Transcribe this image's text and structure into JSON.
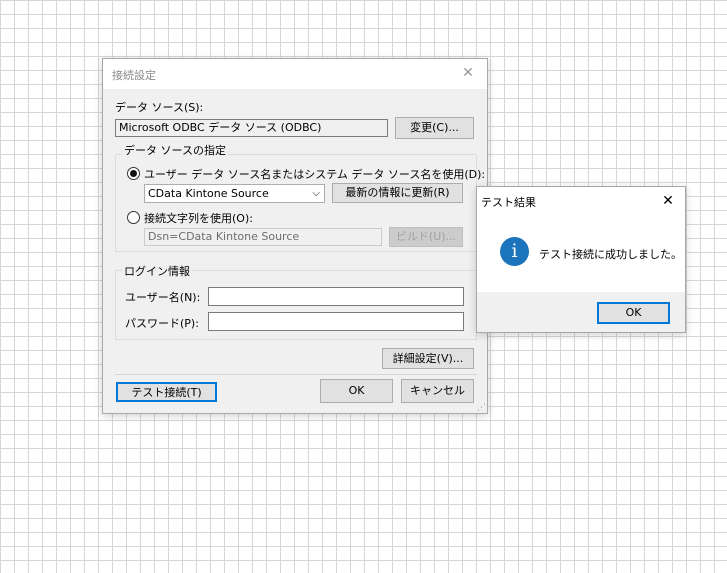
{
  "main_dialog": {
    "title": "接続設定",
    "data_source_label": "データ ソース(S):",
    "data_source_value": "Microsoft ODBC データ ソース (ODBC)",
    "change_button": "変更(C)...",
    "group_title": "データ ソースの指定",
    "use_dsn_label": "ユーザー データ ソース名またはシステム データ ソース名を使用(D):",
    "dsn_select_value": "CData Kintone Source",
    "refresh_button": "最新の情報に更新(R)",
    "use_conn_string_label": "接続文字列を使用(O):",
    "conn_string_value": "Dsn=CData Kintone Source",
    "build_button": "ビルド(U)...",
    "login_group_title": "ログイン情報",
    "username_label": "ユーザー名(N):",
    "username_value": "",
    "password_label": "パスワード(P):",
    "password_value": "",
    "advanced_button": "詳細設定(V)...",
    "test_button": "テスト接続(T)",
    "ok_button": "OK",
    "cancel_button": "キャンセル"
  },
  "result_dialog": {
    "title": "テスト結果",
    "message": "テスト接続に成功しました。",
    "icon_glyph": "i",
    "ok_button": "OK",
    "icon_color": "#1c75bc"
  }
}
